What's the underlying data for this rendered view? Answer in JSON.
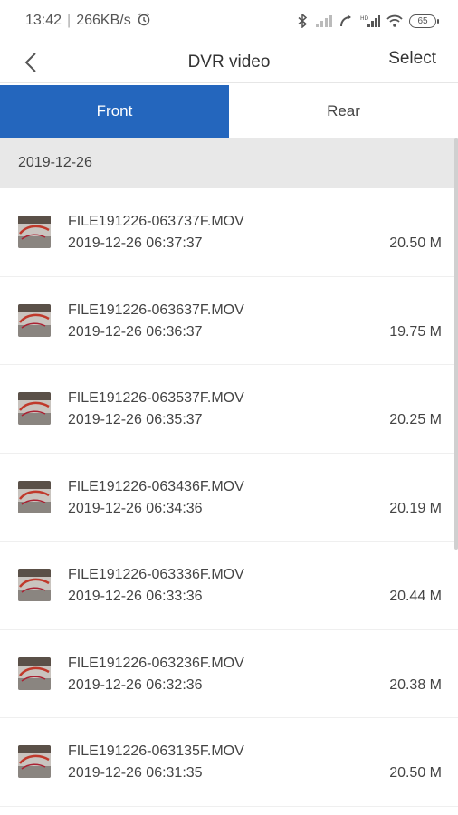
{
  "status": {
    "time": "13:42",
    "speed": "266KB/s",
    "battery": "65"
  },
  "header": {
    "title": "DVR video",
    "select_label": "Select"
  },
  "tabs": [
    {
      "label": "Front",
      "active": true
    },
    {
      "label": "Rear",
      "active": false
    }
  ],
  "group": {
    "date": "2019-12-26"
  },
  "videos": [
    {
      "name": "FILE191226-063737F.MOV",
      "datetime": "2019-12-26 06:37:37",
      "size": "20.50 M"
    },
    {
      "name": "FILE191226-063637F.MOV",
      "datetime": "2019-12-26 06:36:37",
      "size": "19.75 M"
    },
    {
      "name": "FILE191226-063537F.MOV",
      "datetime": "2019-12-26 06:35:37",
      "size": "20.25 M"
    },
    {
      "name": "FILE191226-063436F.MOV",
      "datetime": "2019-12-26 06:34:36",
      "size": "20.19 M"
    },
    {
      "name": "FILE191226-063336F.MOV",
      "datetime": "2019-12-26 06:33:36",
      "size": "20.44 M"
    },
    {
      "name": "FILE191226-063236F.MOV",
      "datetime": "2019-12-26 06:32:36",
      "size": "20.38 M"
    },
    {
      "name": "FILE191226-063135F.MOV",
      "datetime": "2019-12-26 06:31:35",
      "size": "20.50 M"
    }
  ],
  "colors": {
    "accent": "#2466bd",
    "group_header_bg": "#e8e8e8"
  }
}
